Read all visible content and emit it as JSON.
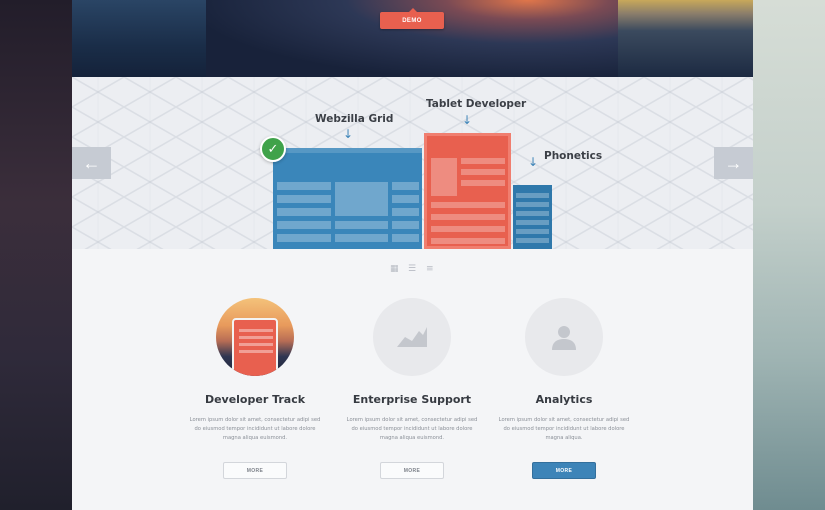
{
  "hero": {
    "demo_label": "DEMO"
  },
  "slider": {
    "labels": {
      "webzilla": "Webzilla Grid",
      "tablet": "Tablet Developer",
      "phonetics": "Phonetics"
    },
    "prev_icon": "arrow-left-icon",
    "next_icon": "arrow-right-icon",
    "check_icon": "check-icon"
  },
  "features": [
    {
      "title": "Developer Track",
      "body": "Lorem ipsum dolor sit amet, consectetur adipi sed do eiusmod tempor incididunt ut labore dolore magna aliqua euismond.",
      "button": "MORE",
      "icon": "tablet-photo-icon"
    },
    {
      "title": "Enterprise Support",
      "body": "Lorem ipsum dolor sit amet, consectetur adipi sed do eiusmod tempor incididunt ut labore dolore magna aliqua euismond.",
      "button": "MORE",
      "icon": "area-chart-icon"
    },
    {
      "title": "Analytics",
      "body": "Lorem ipsum dolor sit amet, consectetur adipi sed do eiusmod tempor incididunt ut labore dolore magna aliqua.",
      "button": "MORE",
      "icon": "user-icon"
    }
  ],
  "colors": {
    "accent_red": "#e8604f",
    "accent_blue": "#3d84b8",
    "check_green": "#3fa24a"
  }
}
